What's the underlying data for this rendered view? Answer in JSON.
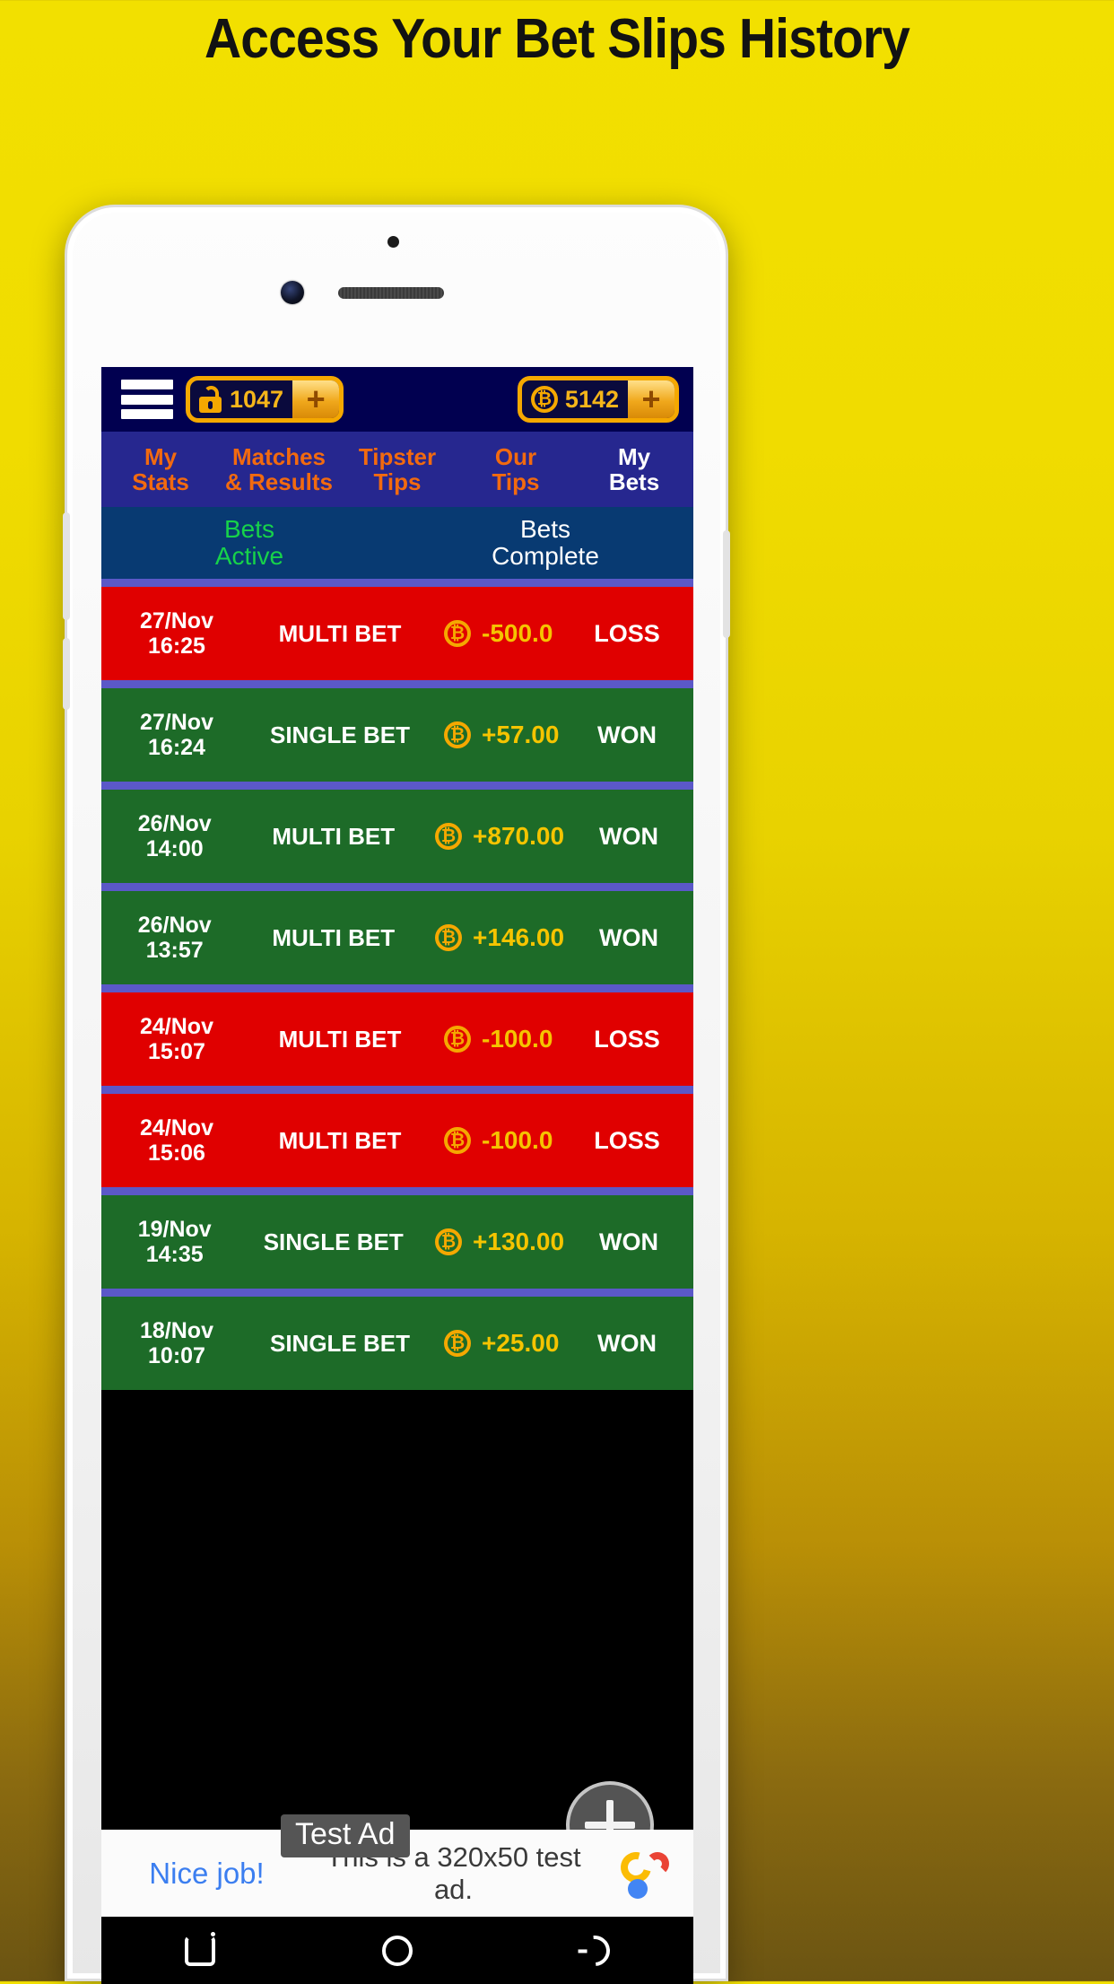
{
  "headline": "Access Your Bet Slips History",
  "app": {
    "topbar": {
      "menu_icon": "hamburger-icon",
      "tickets": {
        "icon": "unlock-icon",
        "value": "1047",
        "add_label": "+"
      },
      "coins": {
        "icon": "bitcoin-icon",
        "value": "5142",
        "add_label": "+"
      }
    },
    "nav_tabs": [
      {
        "label": "My\nStats",
        "line1": "My",
        "line2": "Stats",
        "active": false
      },
      {
        "label": "Matches & Results",
        "line1": "Matches",
        "line2": "& Results",
        "active": false
      },
      {
        "label": "Tipster Tips",
        "line1": "Tipster",
        "line2": "Tips",
        "active": false
      },
      {
        "label": "Our Tips",
        "line1": "Our",
        "line2": "Tips",
        "active": false
      },
      {
        "label": "My Bets",
        "line1": "My",
        "line2": "Bets",
        "active": true
      }
    ],
    "sub_tabs": [
      {
        "line1": "Bets",
        "line2": "Active",
        "selected": true
      },
      {
        "line1": "Bets",
        "line2": "Complete",
        "selected": false
      }
    ],
    "bets": [
      {
        "date": "27/Nov",
        "time": "16:25",
        "type": "MULTI BET",
        "coin_icon": "bitcoin-icon",
        "amount": "-500.0",
        "status": "LOSS",
        "result": "loss"
      },
      {
        "date": "27/Nov",
        "time": "16:24",
        "type": "SINGLE BET",
        "coin_icon": "bitcoin-icon",
        "amount": "+57.00",
        "status": "WON",
        "result": "won"
      },
      {
        "date": "26/Nov",
        "time": "14:00",
        "type": "MULTI BET",
        "coin_icon": "bitcoin-icon",
        "amount": "+870.00",
        "status": "WON",
        "result": "won"
      },
      {
        "date": "26/Nov",
        "time": "13:57",
        "type": "MULTI BET",
        "coin_icon": "bitcoin-icon",
        "amount": "+146.00",
        "status": "WON",
        "result": "won"
      },
      {
        "date": "24/Nov",
        "time": "15:07",
        "type": "MULTI BET",
        "coin_icon": "bitcoin-icon",
        "amount": "-100.0",
        "status": "LOSS",
        "result": "loss"
      },
      {
        "date": "24/Nov",
        "time": "15:06",
        "type": "MULTI BET",
        "coin_icon": "bitcoin-icon",
        "amount": "-100.0",
        "status": "LOSS",
        "result": "loss"
      },
      {
        "date": "19/Nov",
        "time": "14:35",
        "type": "SINGLE BET",
        "coin_icon": "bitcoin-icon",
        "amount": "+130.00",
        "status": "WON",
        "result": "won"
      },
      {
        "date": "18/Nov",
        "time": "10:07",
        "type": "SINGLE BET",
        "coin_icon": "bitcoin-icon",
        "amount": "+25.00",
        "status": "WON",
        "result": "won"
      }
    ],
    "fab": {
      "icon": "plus-icon",
      "label": "+"
    },
    "ad": {
      "left_text": "Nice job!",
      "center_text": "This is a 320x50 test ad.",
      "badge": "Test Ad",
      "logo_icon": "admob-icon"
    },
    "android_nav": [
      {
        "icon": "recents-icon"
      },
      {
        "icon": "home-icon"
      },
      {
        "icon": "back-icon"
      }
    ]
  },
  "colors": {
    "background_yellow": "#f0dc00",
    "topbar_navy": "#010050",
    "navtabs_blue": "#26278f",
    "subtabs_blue": "#083a72",
    "accent_orange": "#f26a0f",
    "gold": "#f5a800",
    "loss_red": "#e00000",
    "won_green": "#1d6b28",
    "separator_purple": "#5b58c8",
    "active_green": "#17d24a"
  }
}
